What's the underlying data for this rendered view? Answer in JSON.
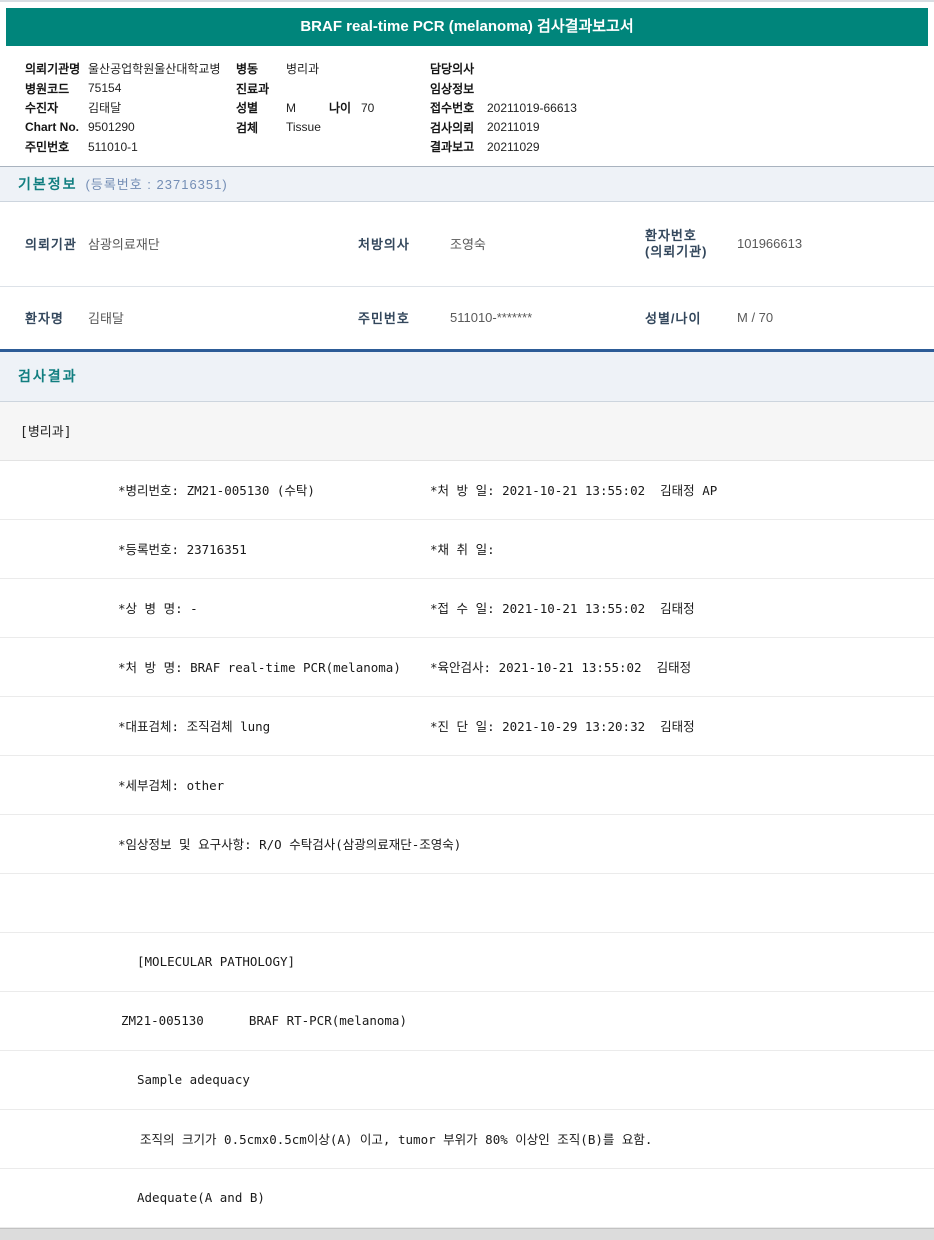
{
  "colors": {
    "header_bg": "#00857B",
    "section_title_text": "#117E80",
    "section_band_bg": "#EEF2F7",
    "navy_divider": "#2D5C97",
    "label_navy": "#33475C"
  },
  "header": {
    "title": "BRAF real-time PCR (melanoma) 검사결과보고서"
  },
  "top_info": {
    "rows": [
      {
        "c1_label": "의뢰기관명",
        "c1_value": "울산공업학원울산대학교병",
        "c2_label": "병동",
        "c2_value": "병리과",
        "c3_label": "담당의사",
        "c3_value": ""
      },
      {
        "c1_label": "병원코드",
        "c1_value": "75154",
        "c2_label": "진료과",
        "c2_value": "",
        "c3_label": "임상정보",
        "c3_value": ""
      },
      {
        "c1_label": "수진자",
        "c1_value": "김태달",
        "c2_label": "성별",
        "c2_value": "M",
        "c2b_label": "나이",
        "c2b_value": "70",
        "c3_label": "접수번호",
        "c3_value": "20211019-66613"
      },
      {
        "c1_label": "Chart No.",
        "c1_value": "9501290",
        "c2_label": "검체",
        "c2_value": "Tissue",
        "c3_label": "검사의뢰",
        "c3_value": "20211019"
      },
      {
        "c1_label": "주민번호",
        "c1_value": "511010-1",
        "c3_label": "결과보고",
        "c3_value": "20211029"
      }
    ]
  },
  "basic_info": {
    "section_title": "기본정보",
    "section_sub": "(등록번호 : 23716351)",
    "rows": [
      {
        "f1_label": "의뢰기관",
        "f1_value": "삼광의료재단",
        "f2_label": "처방의사",
        "f2_value": "조영숙",
        "f3_label_line1": "환자번호",
        "f3_label_line2": "(의뢰기관)",
        "f3_value": "101966613"
      },
      {
        "f1_label": "환자명",
        "f1_value": "김태달",
        "f2_label": "주민번호",
        "f2_value": "511010-*******",
        "f3_label": "성별/나이",
        "f3_value": "M / 70"
      }
    ]
  },
  "results": {
    "section_title": "검사결과",
    "dept": "[병리과]",
    "rows": [
      {
        "left": "*병리번호: ZM21-005130 (수탁)",
        "right": "*처 방 일: 2021-10-21 13:55:02  김태정 AP"
      },
      {
        "left": "*등록번호: 23716351",
        "right": "*채 취 일:"
      },
      {
        "left": "*상 병 명: -",
        "right": "*접 수 일: 2021-10-21 13:55:02  김태정"
      },
      {
        "left": "*처 방 명: BRAF real-time PCR(melanoma)",
        "right": "*육안검사: 2021-10-21 13:55:02  김태정"
      },
      {
        "left": "*대표검체: 조직검체 lung",
        "right": "*진 단 일: 2021-10-29 13:20:32  김태정"
      },
      {
        "left": "*세부검체: other",
        "right": ""
      },
      {
        "left": "*임상정보 및 요구사항: R/O 수탁검사(삼광의료재단-조영숙)",
        "right": ""
      },
      {
        "left": "",
        "right": ""
      },
      {
        "left": "[MOLECULAR PATHOLOGY]",
        "right": ""
      },
      {
        "left": "ZM21-005130      BRAF RT-PCR(melanoma)",
        "right": ""
      },
      {
        "left": "Sample adequacy",
        "right": ""
      },
      {
        "left": "조직의 크기가 0.5cmx0.5cm이상(A) 이고, tumor 부위가 80% 이상인 조직(B)를 요함.",
        "right": ""
      },
      {
        "left": "Adequate(A and B)",
        "right": ""
      }
    ]
  }
}
